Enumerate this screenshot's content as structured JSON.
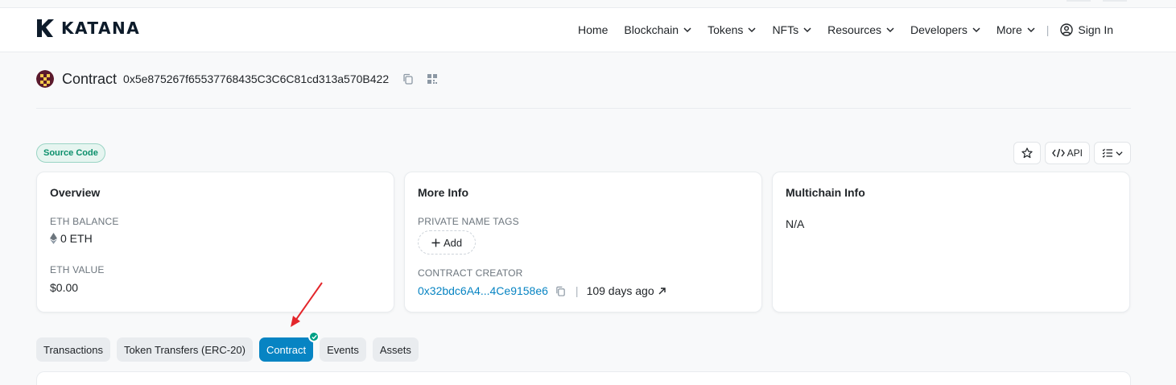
{
  "brand": {
    "name": "KATANA"
  },
  "nav": {
    "items": [
      {
        "label": "Home",
        "has_dropdown": false
      },
      {
        "label": "Blockchain",
        "has_dropdown": true
      },
      {
        "label": "Tokens",
        "has_dropdown": true
      },
      {
        "label": "NFTs",
        "has_dropdown": true
      },
      {
        "label": "Resources",
        "has_dropdown": true
      },
      {
        "label": "Developers",
        "has_dropdown": true
      },
      {
        "label": "More",
        "has_dropdown": true
      }
    ],
    "divider": "|",
    "sign_in": "Sign In"
  },
  "contract": {
    "title": "Contract",
    "address": "0x5e875267f65537768435C3C6C81cd313a570B422"
  },
  "badge": {
    "label": "Source Code"
  },
  "actions": {
    "api_label": "API"
  },
  "cards": {
    "overview": {
      "title": "Overview",
      "balance_label": "ETH BALANCE",
      "balance_value": "0 ETH",
      "value_label": "ETH VALUE",
      "value_value": "$0.00"
    },
    "more_info": {
      "title": "More Info",
      "tags_label": "PRIVATE NAME TAGS",
      "add_label": "Add",
      "creator_label": "CONTRACT CREATOR",
      "creator_address": "0x32bdc6A4...4Ce9158e6",
      "separator": "|",
      "age": "109 days ago"
    },
    "multichain": {
      "title": "Multichain Info",
      "value": "N/A"
    }
  },
  "tabs": [
    {
      "label": "Transactions",
      "active": false
    },
    {
      "label": "Token Transfers (ERC-20)",
      "active": false
    },
    {
      "label": "Contract",
      "active": true,
      "verified": true
    },
    {
      "label": "Events",
      "active": false
    },
    {
      "label": "Assets",
      "active": false
    }
  ],
  "colors": {
    "accent": "#0784c3",
    "success": "#00a186",
    "annotation_arrow": "#e3262b"
  }
}
